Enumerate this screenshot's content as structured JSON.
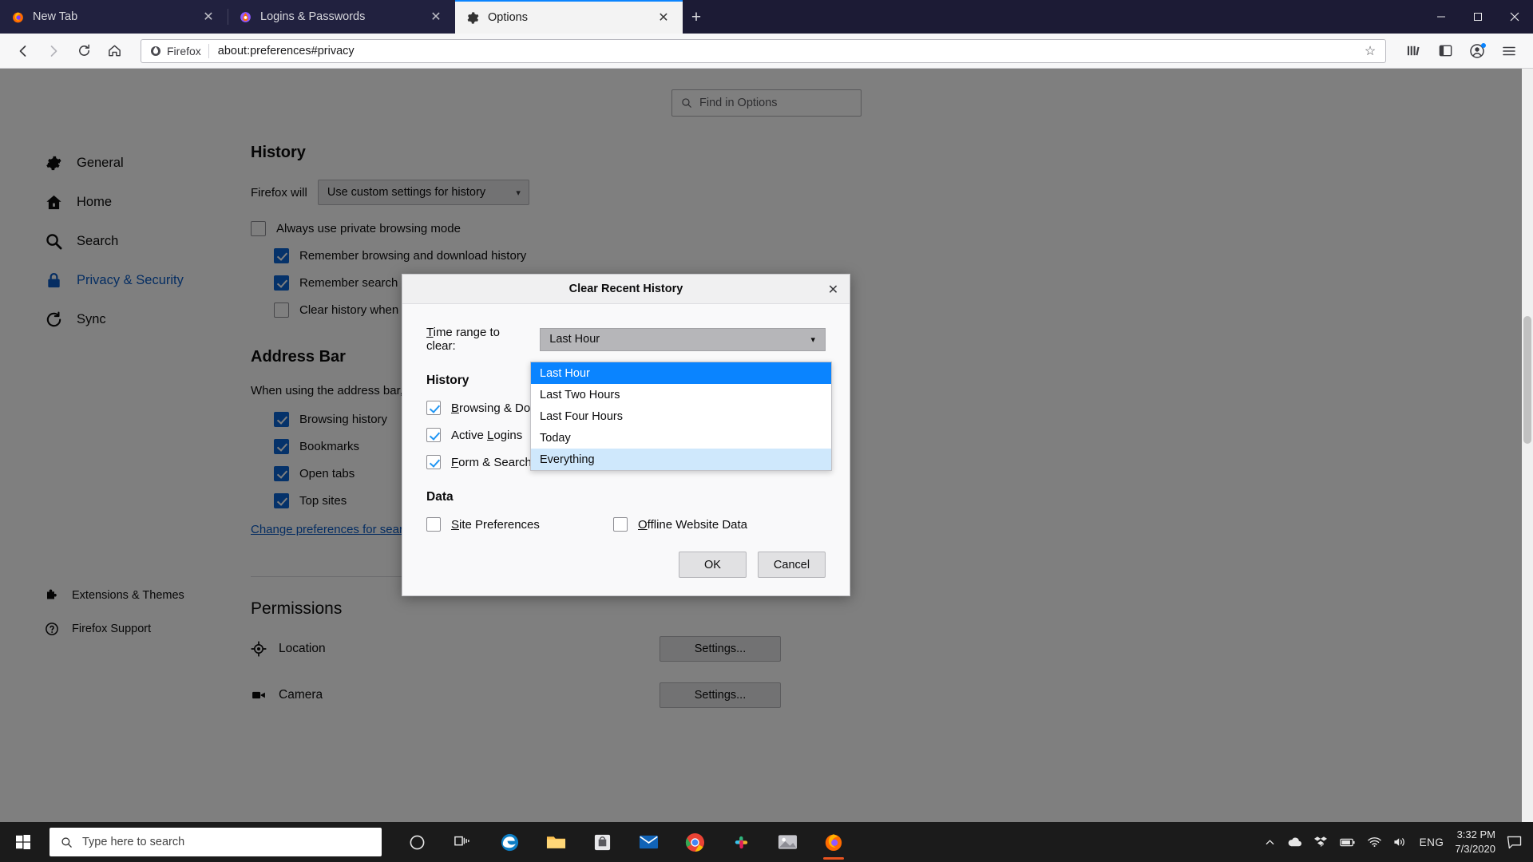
{
  "window": {
    "tabs": [
      {
        "label": "New Tab",
        "favicon": "firefox-icon",
        "active": false
      },
      {
        "label": "Logins & Passwords",
        "favicon": "lockwise-icon",
        "active": false
      },
      {
        "label": "Options",
        "favicon": "gear-icon",
        "active": true
      }
    ],
    "new_tab_label": "+",
    "controls": {
      "minimize": "—",
      "maximize": "❑",
      "close": "✕"
    }
  },
  "navbar": {
    "back": "←",
    "forward": "→",
    "reload": "⟳",
    "home": "⌂",
    "identity_label": "Firefox",
    "url": "about:preferences#privacy",
    "star": "☆",
    "library": "library-icon",
    "sidebar": "sidebar-icon",
    "account": "account-icon",
    "menu": "☰"
  },
  "find": {
    "placeholder": "Find in Options",
    "icon": "search-icon"
  },
  "sidebar": {
    "items": [
      {
        "label": "General",
        "icon": "gear-icon",
        "selected": false
      },
      {
        "label": "Home",
        "icon": "home-icon",
        "selected": false
      },
      {
        "label": "Search",
        "icon": "search-icon",
        "selected": false
      },
      {
        "label": "Privacy & Security",
        "icon": "lock-icon",
        "selected": true
      },
      {
        "label": "Sync",
        "icon": "sync-icon",
        "selected": false
      }
    ],
    "bottom": [
      {
        "label": "Extensions & Themes",
        "icon": "puzzle-icon"
      },
      {
        "label": "Firefox Support",
        "icon": "help-icon"
      }
    ]
  },
  "main": {
    "history": {
      "title": "History",
      "firefox_will_label": "Firefox will",
      "firefox_will_value": "Use custom settings for history",
      "checkboxes": [
        {
          "label": "Always use private browsing mode",
          "checked": false,
          "indent": false
        },
        {
          "label": "Remember browsing and download history",
          "checked": true,
          "indent": true
        },
        {
          "label": "Remember search and form history",
          "checked": true,
          "indent": true
        },
        {
          "label": "Clear history when Firefox closes",
          "checked": false,
          "indent": true
        }
      ]
    },
    "address_bar": {
      "title": "Address Bar",
      "description": "When using the address bar, suggest",
      "checkboxes": [
        {
          "label": "Browsing history",
          "checked": true
        },
        {
          "label": "Bookmarks",
          "checked": true
        },
        {
          "label": "Open tabs",
          "checked": true
        },
        {
          "label": "Top sites",
          "checked": true
        }
      ],
      "link": "Change preferences for search engine suggestions"
    },
    "permissions": {
      "title": "Permissions",
      "rows": [
        {
          "label": "Location",
          "icon": "location-icon",
          "button": "Settings..."
        },
        {
          "label": "Camera",
          "icon": "camera-icon",
          "button": "Settings..."
        }
      ]
    }
  },
  "dialog": {
    "title": "Clear Recent History",
    "close": "✕",
    "time_range_label": "Time range to clear:",
    "time_range_value": "Last Hour",
    "caret": "⌄",
    "options": [
      {
        "label": "Last Hour",
        "state": "selected"
      },
      {
        "label": "Last Two Hours",
        "state": "normal"
      },
      {
        "label": "Last Four Hours",
        "state": "normal"
      },
      {
        "label": "Today",
        "state": "normal"
      },
      {
        "label": "Everything",
        "state": "hover"
      }
    ],
    "history_heading": "History",
    "history_items": [
      {
        "label": "Browsing & Download History",
        "checked": true
      },
      {
        "label": "Active Logins",
        "checked": true
      },
      {
        "label": "Form & Search History",
        "checked": true
      }
    ],
    "data_heading": "Data",
    "data_items": [
      {
        "label": "Site Preferences",
        "checked": false
      },
      {
        "label": "Offline Website Data",
        "checked": false
      }
    ],
    "ok": "OK",
    "cancel": "Cancel"
  },
  "taskbar": {
    "search_placeholder": "Type here to search",
    "cortana": "○",
    "taskview": "taskview-icon",
    "apps": [
      "edge-icon",
      "explorer-icon",
      "store-icon",
      "mail-icon",
      "chrome-icon",
      "slack-icon",
      "photos-icon",
      "firefox-icon"
    ],
    "tray": {
      "chevron": "∧",
      "onedrive": "onedrive-icon",
      "dropbox": "dropbox-icon",
      "battery": "battery-icon",
      "wifi": "wifi-icon",
      "volume": "volume-icon"
    },
    "lang": "ENG",
    "time": "3:32 PM",
    "date": "7/3/2020",
    "notifications": "notification-icon"
  },
  "colors": {
    "accent": "#0a84ff",
    "hover": "#cfe8fc",
    "link": "#0a5bc4",
    "tabbar": "#1c1b35"
  }
}
